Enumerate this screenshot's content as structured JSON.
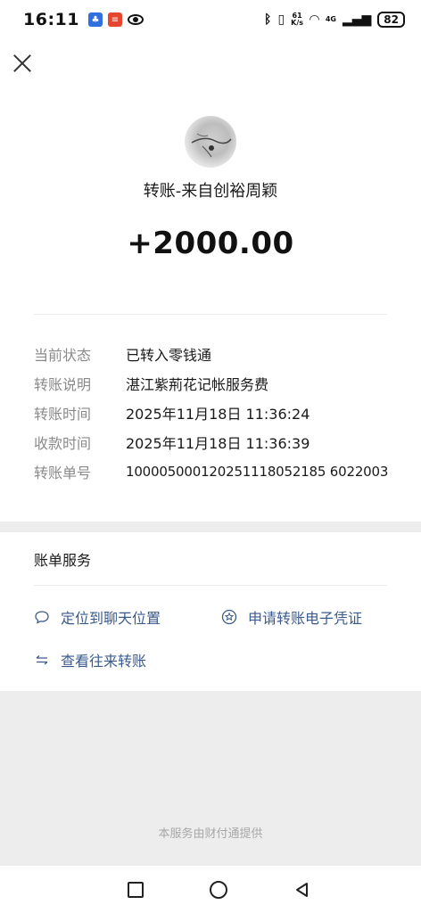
{
  "status_bar": {
    "time": "16:11",
    "network_speed_value": "61",
    "network_speed_unit": "K/s",
    "signal_label": "4G",
    "battery": "82"
  },
  "header": {
    "title": "转账-来自创裕周颖",
    "amount": "+2000.00"
  },
  "details": [
    {
      "label": "当前状态",
      "value": "已转入零钱通"
    },
    {
      "label": "转账说明",
      "value": "湛江紫荊花记帐服务费"
    },
    {
      "label": "转账时间",
      "value": "2025年11月18日 11:36:24"
    },
    {
      "label": "收款时间",
      "value": "2025年11月18日 11:36:39"
    },
    {
      "label": "转账单号",
      "value": "100005000120251118052185 6022003"
    }
  ],
  "bill_services": {
    "title": "账单服务",
    "locate_chat": "定位到聊天位置",
    "apply_voucher": "申请转账电子凭证",
    "view_history": "查看往来转账"
  },
  "footer": {
    "provider": "本服务由财付通提供"
  },
  "colors": {
    "link": "#3a5a8c",
    "label": "#8a8a8a",
    "band": "#ededed"
  }
}
